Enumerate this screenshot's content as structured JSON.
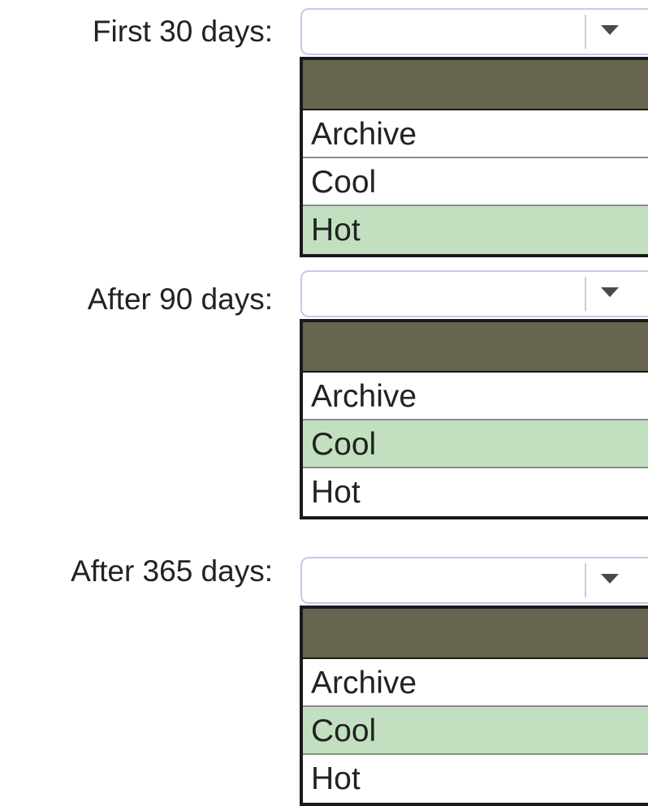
{
  "groups": [
    {
      "label": "First 30 days:",
      "options": [
        "Archive",
        "Cool",
        "Hot"
      ],
      "highlighted": "Hot"
    },
    {
      "label": "After 90 days:",
      "options": [
        "Archive",
        "Cool",
        "Hot"
      ],
      "highlighted": "Cool"
    },
    {
      "label": "After 365 days:",
      "options": [
        "Archive",
        "Cool",
        "Hot"
      ],
      "highlighted": "Cool"
    }
  ],
  "colors": {
    "header": "#66644f",
    "highlight": "#c2e0c0",
    "combo_border": "#c9c6ea"
  },
  "icons": {
    "dropdown_arrow": "chevron-down-icon"
  }
}
